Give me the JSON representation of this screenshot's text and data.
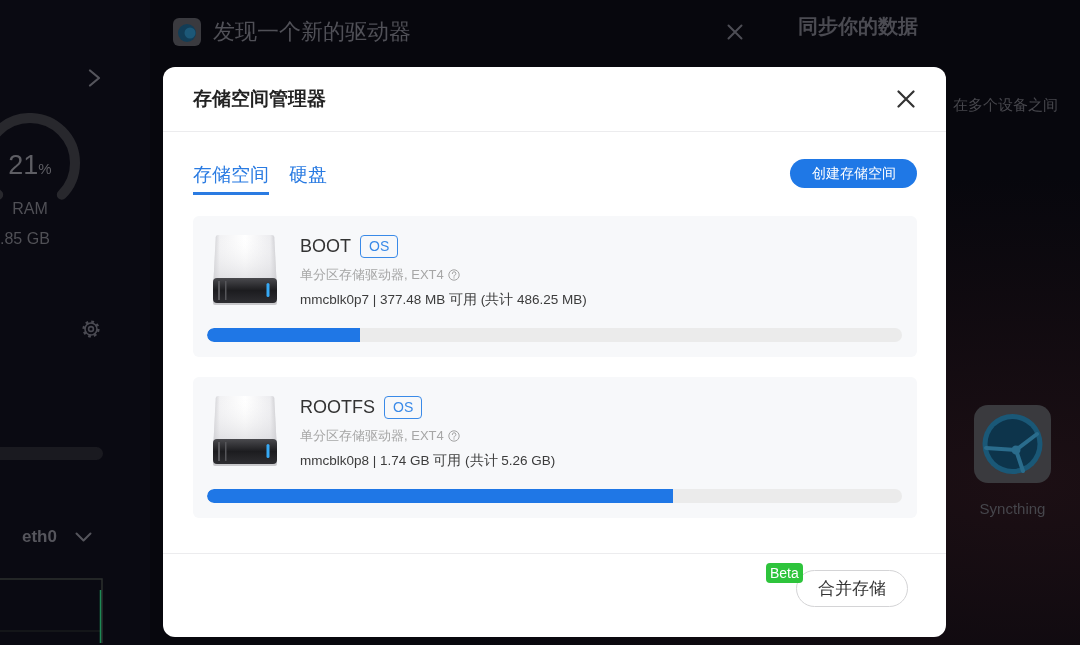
{
  "desktop": {
    "side_panel": {
      "ram": {
        "value": "21",
        "unit": "%",
        "label": "RAM",
        "amount": ".85 GB"
      },
      "network": {
        "interface": "eth0"
      }
    },
    "notification": {
      "title": "发现一个新的驱动器"
    },
    "sync_panel": {
      "title": "同步你的数据",
      "description": "在多个设备之间"
    },
    "apps": [
      {
        "name": "Syncthing"
      }
    ]
  },
  "dialog": {
    "title": "存储空间管理器",
    "tabs": [
      {
        "label": "存储空间",
        "selected": true
      },
      {
        "label": "硬盘",
        "selected": false
      }
    ],
    "create_button": "创建存储空间",
    "volumes": [
      {
        "name": "BOOT",
        "badge": "OS",
        "description": "单分区存储驱动器, EXT4",
        "usage": "mmcblk0p7 | 377.48 MB 可用 (共计 486.25 MB)",
        "level": 0.22
      },
      {
        "name": "ROOTFS",
        "badge": "OS",
        "description": "单分区存储驱动器, EXT4",
        "usage": "mmcblk0p8 | 1.74 GB 可用 (共计 5.26 GB)",
        "level": 0.67
      }
    ],
    "merge_button": {
      "label": "合并存储",
      "badge": "Beta"
    }
  }
}
